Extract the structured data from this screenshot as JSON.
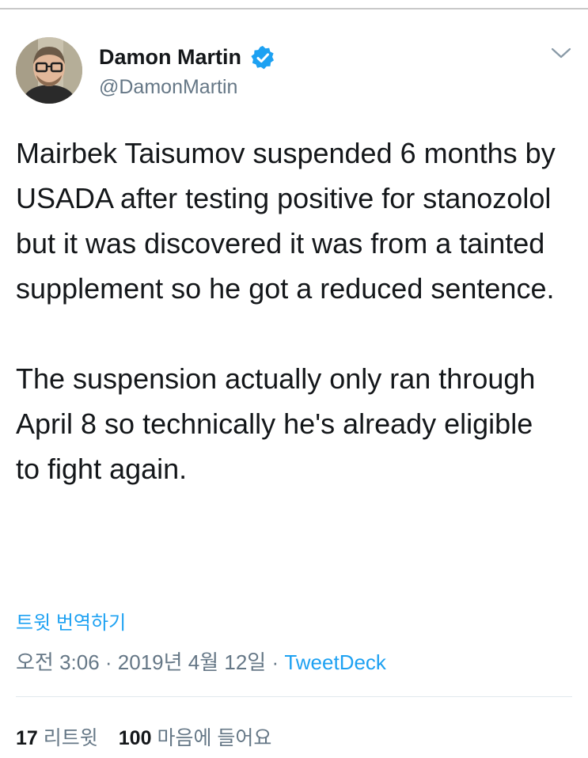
{
  "author": {
    "display_name": "Damon Martin",
    "handle": "@DamonMartin",
    "verified": true
  },
  "tweet": {
    "text": "Mairbek Taisumov suspended 6 months by USADA after testing positive for stanozolol but it was discovered it was from a tainted supplement so he got a reduced sentence.\n\nThe suspension actually only ran through April 8 so technically he's already eligible to fight again.",
    "translate_label": "트윗 번역하기",
    "time": "오전 3:06",
    "separator1": " · ",
    "date": "2019년 4월 12일",
    "separator2": " · ",
    "source": "TweetDeck"
  },
  "stats": {
    "retweets_count": "17",
    "retweets_label": "리트윗",
    "likes_count": "100",
    "likes_label": "마음에 들어요"
  },
  "icons": {
    "verified": "verified-badge-icon",
    "caret": "chevron-down-icon"
  },
  "colors": {
    "link": "#1da1f2",
    "secondary_text": "#657786",
    "primary_text": "#14171a"
  }
}
